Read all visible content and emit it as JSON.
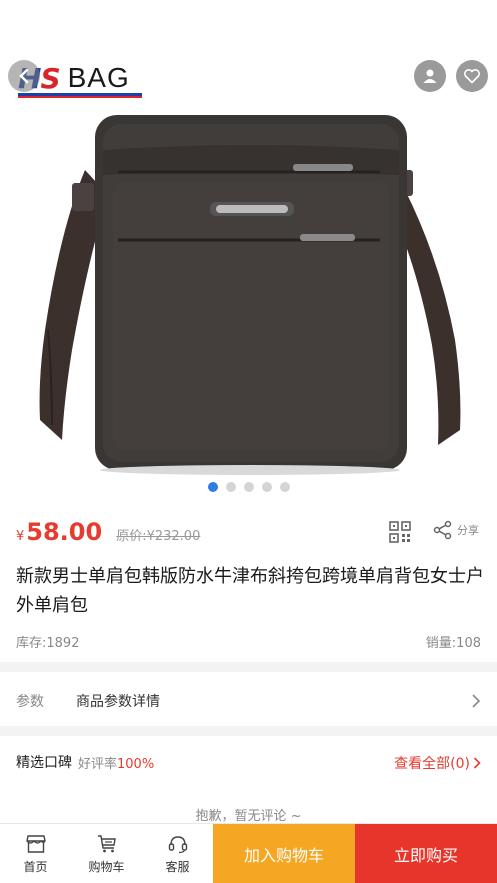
{
  "header": {
    "logo_mark": "HS",
    "logo_word": "BAG"
  },
  "icons": {
    "back": "back-arrow-icon",
    "user": "user-icon",
    "favorite": "heart-icon",
    "qr": "qr-code-icon",
    "share": "share-icon",
    "home": "home-icon",
    "cart": "cart-icon",
    "service": "headset-icon",
    "chevron": "chevron-right-icon"
  },
  "gallery": {
    "page_count": 5,
    "active_index": 0
  },
  "product": {
    "currency": "¥",
    "price": "58.00",
    "original_price": "原价:¥232.00",
    "title": "新款男士单肩包韩版防水牛津布斜挎包跨境单肩背包女士户外单肩包",
    "stock": "库存:1892",
    "sales": "销量:108",
    "share_label": "分享"
  },
  "params": {
    "label": "参数",
    "value": "商品参数详情"
  },
  "reviews": {
    "title": "精选口碑",
    "rate_label": "好评率",
    "rate_value": "100%",
    "see_all": "查看全部(0)",
    "empty": "抱歉，暂无评论 ~"
  },
  "bottom_bar": {
    "home": "首页",
    "cart": "购物车",
    "service": "客服",
    "add_to_cart": "加入购物车",
    "buy_now": "立即购买"
  },
  "colors": {
    "accent_red": "#e63b2e",
    "add_cart_orange": "#f5a623",
    "buy_red": "#e8352b",
    "active_dot": "#2f7de1"
  }
}
